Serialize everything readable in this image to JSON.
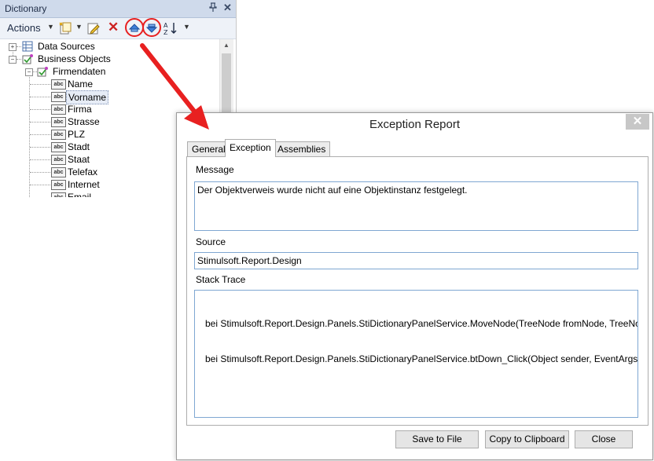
{
  "dictionary": {
    "title": "Dictionary",
    "pin_glyph": "ᵖ",
    "close_glyph": "✕",
    "toolbar": {
      "actions_label": "Actions",
      "icons": [
        "new-item-icon",
        "edit-icon",
        "delete-icon",
        "move-up-icon",
        "move-down-icon",
        "sort-icon"
      ]
    },
    "tree": {
      "roots": [
        {
          "label": "Data Sources",
          "icon": "datasource-icon",
          "expanded": false
        },
        {
          "label": "Business Objects",
          "icon": "business-object-icon",
          "expanded": true
        }
      ],
      "business_object": {
        "label": "Firmendaten",
        "icon": "business-object-icon"
      },
      "columns": [
        "Name",
        "Vorname",
        "Firma",
        "Strasse",
        "PLZ",
        "Stadt",
        "Staat",
        "Telefax",
        "Internet",
        "Email"
      ],
      "selected": "Vorname",
      "column_icon_text": "abc"
    }
  },
  "dialog": {
    "title": "Exception Report",
    "close_glyph": "✕",
    "tabs": [
      "General",
      "Exception",
      "Assemblies"
    ],
    "active_tab": "Exception",
    "message_label": "Message",
    "message_value": "Der Objektverweis wurde nicht auf eine Objektinstanz festgelegt.",
    "source_label": "Source",
    "source_value": "Stimulsoft.Report.Design",
    "stack_label": "Stack Trace",
    "stack_lines": [
      "   bei Stimulsoft.Report.Design.Panels.StiDictionaryPanelService.MoveNode(TreeNode fromNode, TreeNode toNode)",
      "   bei Stimulsoft.Report.Design.Panels.StiDictionaryPanelService.btDown_Click(Object sender, EventArgs e)"
    ],
    "buttons": {
      "save": "Save to File",
      "copy": "Copy to Clipboard",
      "close": "Close"
    }
  },
  "colors": {
    "annotation_red": "#e82020",
    "title_bar": "#cfdaeb",
    "field_border": "#7fa7d2"
  }
}
